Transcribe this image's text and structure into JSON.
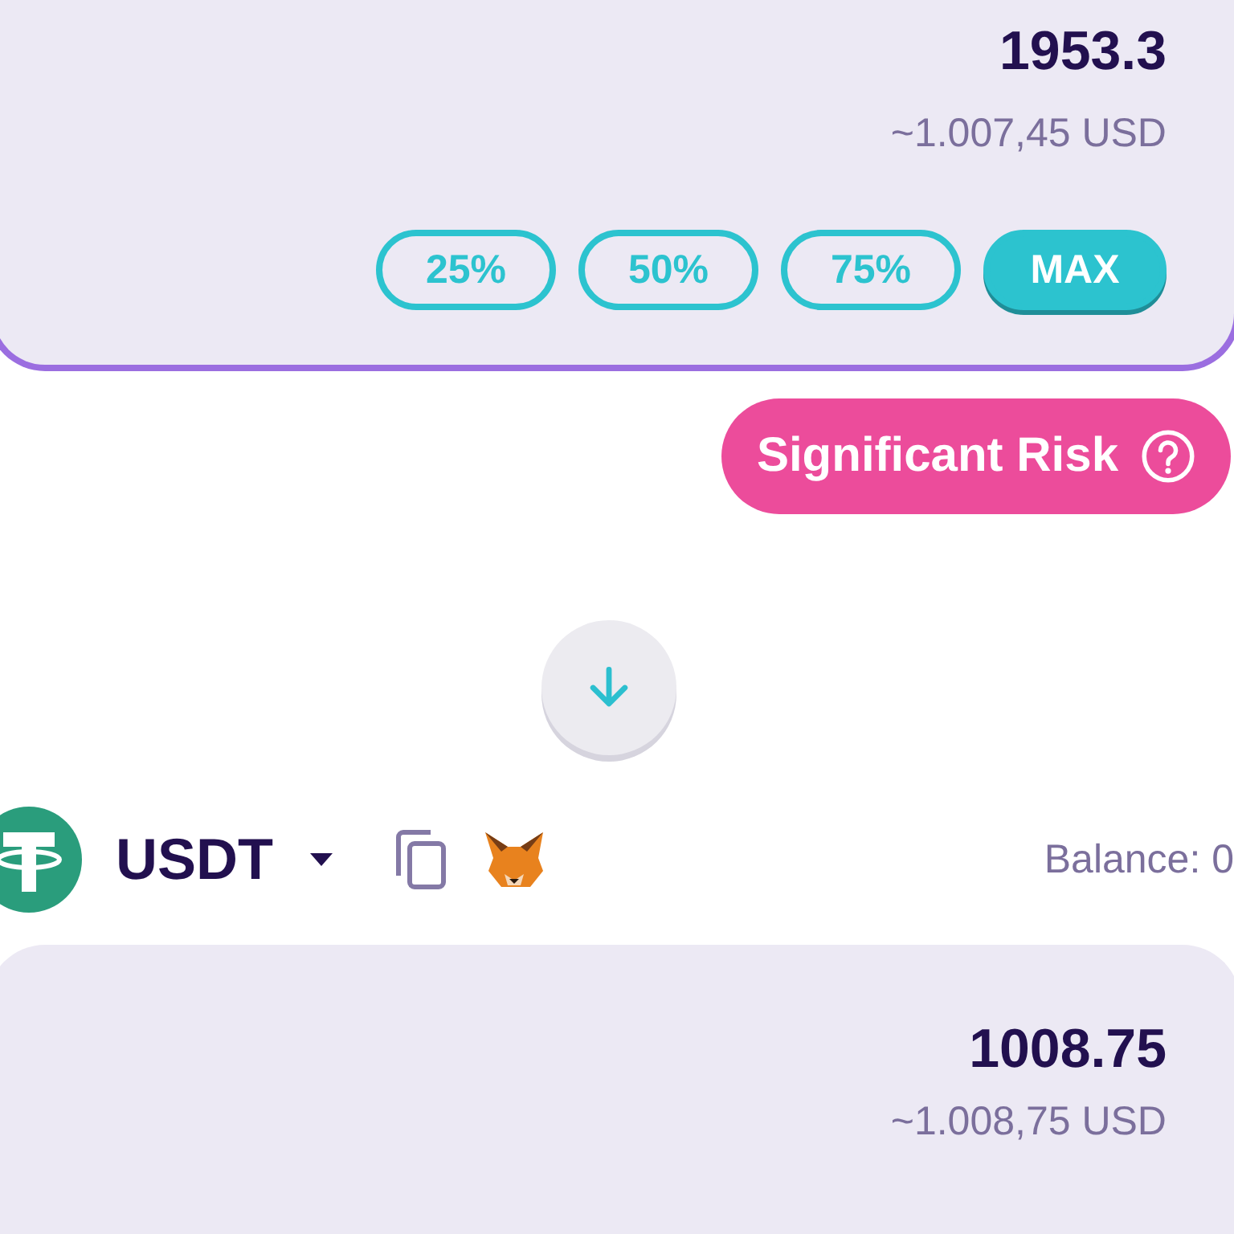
{
  "from_panel": {
    "amount": "1953.3",
    "usd_value": "~1.007,45 USD",
    "percent_buttons": [
      {
        "label": "25%",
        "selected": false
      },
      {
        "label": "50%",
        "selected": false
      },
      {
        "label": "75%",
        "selected": false
      },
      {
        "label": "MAX",
        "selected": true
      }
    ]
  },
  "risk_badge": {
    "label": "Significant Risk"
  },
  "to_token": {
    "symbol": "USDT",
    "balance": "Balance: 0"
  },
  "to_panel": {
    "amount": "1008.75",
    "usd_value": "~1.008,75 USD"
  }
}
